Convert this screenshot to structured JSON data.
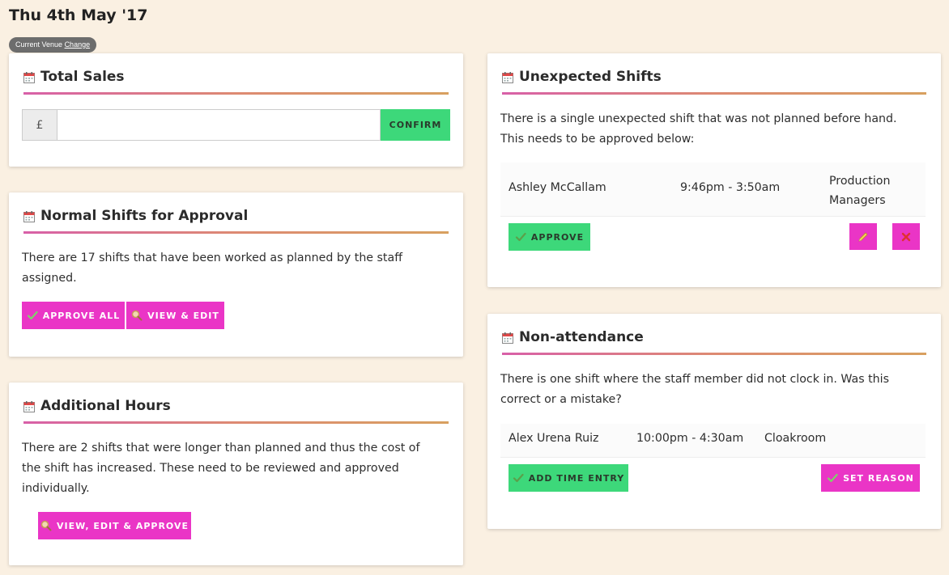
{
  "page": {
    "title": "Thu 4th May '17"
  },
  "venue": {
    "label": "Current Venue",
    "change_link": "Change"
  },
  "total_sales": {
    "title": "Total Sales",
    "currency_prefix": "£",
    "value": "",
    "confirm_label": "CONFIRM"
  },
  "normal_shifts": {
    "title": "Normal Shifts for Approval",
    "description_line1": "There are 17 shifts that have been worked as planned by the staff",
    "description_line2": "assigned.",
    "approve_all_label": "APPROVE ALL",
    "view_edit_label": "VIEW & EDIT"
  },
  "additional_hours": {
    "title": "Additional Hours",
    "description_line1": "There are 2 shifts that were longer than planned and thus the cost of",
    "description_line2": "the shift has increased. These need to be reviewed and approved",
    "description_line3": "individually.",
    "action_label": "VIEW, EDIT & APPROVE"
  },
  "unexpected_shifts": {
    "title": "Unexpected Shifts",
    "description_line1": "There is a single unexpected shift that was not planned before hand.",
    "description_line2": "This needs to be approved below:",
    "row": {
      "name": "Ashley McCallam",
      "time": "9:46pm - 3:50am",
      "role_line1": "Production",
      "role_line2": "Managers"
    },
    "approve_label": "APPROVE"
  },
  "non_attendance": {
    "title": "Non-attendance",
    "description_line1": "There is one shift where the staff member did not clock in. Was this",
    "description_line2": "correct or a mistake?",
    "row": {
      "name": "Alex Urena Ruiz",
      "time": "10:00pm - 4:30am",
      "role": "Cloakroom"
    },
    "add_time_label": "ADD TIME ENTRY",
    "set_reason_label": "SET REASON"
  },
  "colors": {
    "background": "#faf0e2",
    "green": "#3dd87a",
    "pink": "#ea35c6",
    "rule_start": "#d860a8",
    "rule_end": "#d8a060"
  }
}
